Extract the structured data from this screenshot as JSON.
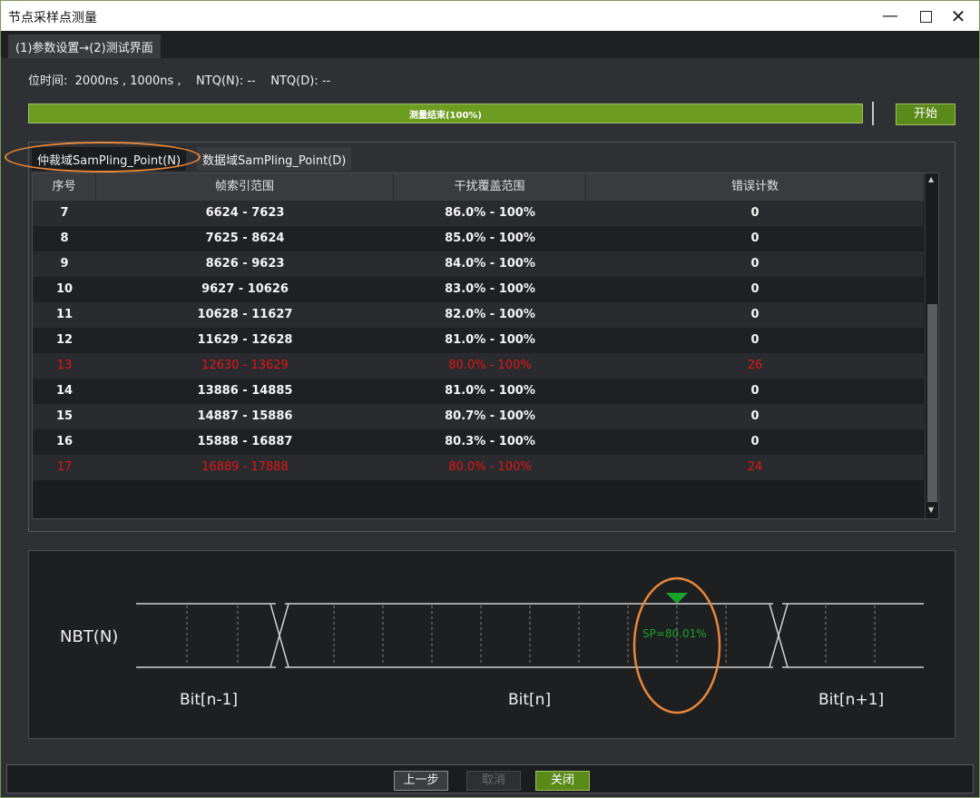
{
  "window": {
    "title": "节点采样点测量",
    "minimize_glyph": "—",
    "close_glyph": "✕"
  },
  "nav": {
    "breadcrumb": "(1)参数设置→(2)测试界面"
  },
  "params": {
    "bit_time_label": "位时间:",
    "bit_time_value": "2000ns , 1000ns ,",
    "ntq_n_label": "NTQ(N):",
    "ntq_n_value": "--",
    "ntq_d_label": "NTQ(D):",
    "ntq_d_value": "--"
  },
  "progress": {
    "label": "测量结束(100%)",
    "percent": 100
  },
  "buttons": {
    "start": "开始",
    "prev": "上一步",
    "cancel": "取消",
    "close": "关闭"
  },
  "tabs": {
    "arbitration": "仲裁域SamPling_Point(N)",
    "data": "数据域SamPling_Point(D)"
  },
  "table": {
    "headers": [
      "序号",
      "帧索引范围",
      "干扰覆盖范围",
      "错误计数"
    ],
    "rows": [
      {
        "id": "7",
        "range": "6624 - 7623",
        "coverage": "86.0% - 100%",
        "errors": "0",
        "error": false
      },
      {
        "id": "8",
        "range": "7625 - 8624",
        "coverage": "85.0% - 100%",
        "errors": "0",
        "error": false
      },
      {
        "id": "9",
        "range": "8626 - 9623",
        "coverage": "84.0% - 100%",
        "errors": "0",
        "error": false
      },
      {
        "id": "10",
        "range": "9627 - 10626",
        "coverage": "83.0% - 100%",
        "errors": "0",
        "error": false
      },
      {
        "id": "11",
        "range": "10628 - 11627",
        "coverage": "82.0% - 100%",
        "errors": "0",
        "error": false
      },
      {
        "id": "12",
        "range": "11629 - 12628",
        "coverage": "81.0% - 100%",
        "errors": "0",
        "error": false
      },
      {
        "id": "13",
        "range": "12630 - 13629",
        "coverage": "80.0% - 100%",
        "errors": "26",
        "error": true
      },
      {
        "id": "14",
        "range": "13886 - 14885",
        "coverage": "81.0% - 100%",
        "errors": "0",
        "error": false
      },
      {
        "id": "15",
        "range": "14887 - 15886",
        "coverage": "80.7% - 100%",
        "errors": "0",
        "error": false
      },
      {
        "id": "16",
        "range": "15888 - 16887",
        "coverage": "80.3% - 100%",
        "errors": "0",
        "error": false
      },
      {
        "id": "17",
        "range": "16889 - 17888",
        "coverage": "80.0% - 100%",
        "errors": "24",
        "error": true
      }
    ]
  },
  "diagram": {
    "signal": "NBT(N)",
    "bits": [
      "Bit[n-1]",
      "Bit[n]",
      "Bit[n+1]"
    ],
    "sample_point": "SP=80.01%"
  },
  "colors": {
    "accent_green": "#6c9c20",
    "error_red": "#e01616",
    "highlight_orange": "#e8873a",
    "marker_green": "#1aa32a"
  }
}
